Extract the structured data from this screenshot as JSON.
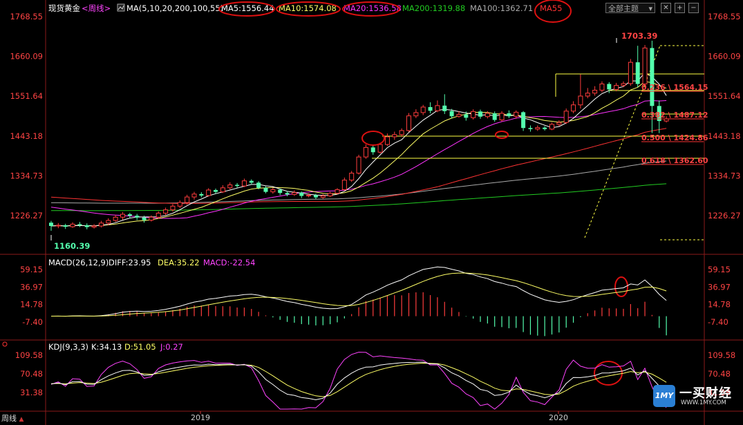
{
  "header": {
    "instrument": "现货黄金",
    "period_tag": "<周线>",
    "ma_params": "MA(5,10,20,200,100,55)",
    "ma5": "MA5:1556.44",
    "ma10": "MA10:1574.08",
    "ma20": "MA20:1536.58",
    "ma200": "MA200:1319.88",
    "ma100": "MA100:1362.71",
    "ma55": "MA55",
    "theme_button": "全部主题"
  },
  "macd_header": {
    "params": "MACD(26,12,9)",
    "diff": "DIFF:23.95",
    "dea": "DEA:35.22",
    "macd": "MACD:-22.54"
  },
  "kdj_header": {
    "params": "KDJ(9,3,3)",
    "k": "K:34.13",
    "d": "D:51.05",
    "j": "J:0.27"
  },
  "footer": {
    "period_button": "周线",
    "x_labels": [
      "2019",
      "2020"
    ]
  },
  "brand": {
    "logo_mark": "1MY",
    "name": "一买财经",
    "url": "WWW.1MY.COM"
  },
  "colors": {
    "up": "#ff3d3d",
    "down": "#54ffae",
    "ma5": "#ffffff",
    "ma10": "#ffff66",
    "ma20": "#ff33ff",
    "ma200": "#22cc22",
    "ma100": "#aaaaaa",
    "ma55": "#ff3333",
    "fib": "#ffff44",
    "annot": "#dd1111",
    "axis_text": "#ff4444"
  },
  "chart_data": [
    {
      "type": "candlestick",
      "title": "现货黄金<周线>",
      "y_ticks": [
        "1768.55",
        "1660.09",
        "1551.64",
        "1443.18",
        "1334.73",
        "1226.27"
      ],
      "ylim": [
        1150,
        1780
      ],
      "high_label": "1703.39",
      "low_label": "1160.39",
      "fibonacci": [
        {
          "ratio": "0.236",
          "price": "1564.15"
        },
        {
          "ratio": "0.382",
          "price": "1487.12"
        },
        {
          "ratio": "0.500",
          "price": "1424.86"
        },
        {
          "ratio": "0.618",
          "price": "1362.60"
        }
      ],
      "candles": [
        [
          1207,
          1198,
          1212,
          1185
        ],
        [
          1198,
          1200,
          1206,
          1192
        ],
        [
          1200,
          1196,
          1204,
          1190
        ],
        [
          1196,
          1203,
          1208,
          1193
        ],
        [
          1203,
          1200,
          1209,
          1195
        ],
        [
          1200,
          1195,
          1205,
          1189
        ],
        [
          1195,
          1198,
          1203,
          1191
        ],
        [
          1198,
          1206,
          1212,
          1194
        ],
        [
          1206,
          1213,
          1219,
          1200
        ],
        [
          1213,
          1222,
          1228,
          1209
        ],
        [
          1222,
          1230,
          1236,
          1215
        ],
        [
          1230,
          1226,
          1234,
          1219
        ],
        [
          1226,
          1221,
          1231,
          1214
        ],
        [
          1221,
          1214,
          1226,
          1207
        ],
        [
          1214,
          1222,
          1227,
          1210
        ],
        [
          1222,
          1233,
          1238,
          1218
        ],
        [
          1233,
          1242,
          1248,
          1228
        ],
        [
          1242,
          1252,
          1258,
          1237
        ],
        [
          1252,
          1262,
          1268,
          1247
        ],
        [
          1262,
          1277,
          1283,
          1256
        ],
        [
          1277,
          1285,
          1291,
          1270
        ],
        [
          1285,
          1281,
          1290,
          1276
        ],
        [
          1281,
          1296,
          1301,
          1278
        ],
        [
          1296,
          1291,
          1300,
          1286
        ],
        [
          1291,
          1302,
          1309,
          1288
        ],
        [
          1302,
          1310,
          1317,
          1298
        ],
        [
          1310,
          1307,
          1315,
          1302
        ],
        [
          1307,
          1321,
          1327,
          1304
        ],
        [
          1321,
          1316,
          1325,
          1311
        ],
        [
          1316,
          1302,
          1320,
          1298
        ],
        [
          1302,
          1291,
          1306,
          1287
        ],
        [
          1291,
          1297,
          1302,
          1286
        ],
        [
          1297,
          1288,
          1300,
          1282
        ],
        [
          1288,
          1284,
          1293,
          1279
        ],
        [
          1284,
          1289,
          1295,
          1280
        ],
        [
          1289,
          1280,
          1292,
          1274
        ],
        [
          1280,
          1282,
          1287,
          1276
        ],
        [
          1282,
          1276,
          1286,
          1271
        ],
        [
          1276,
          1280,
          1285,
          1272
        ],
        [
          1280,
          1287,
          1291,
          1277
        ],
        [
          1287,
          1297,
          1301,
          1284
        ],
        [
          1297,
          1323,
          1330,
          1294
        ],
        [
          1323,
          1342,
          1348,
          1318
        ],
        [
          1342,
          1386,
          1392,
          1338
        ],
        [
          1386,
          1412,
          1420,
          1381
        ],
        [
          1412,
          1399,
          1420,
          1392
        ],
        [
          1399,
          1420,
          1425,
          1395
        ],
        [
          1420,
          1441,
          1450,
          1416
        ],
        [
          1441,
          1447,
          1455,
          1433
        ],
        [
          1447,
          1458,
          1464,
          1441
        ],
        [
          1458,
          1498,
          1506,
          1454
        ],
        [
          1498,
          1507,
          1516,
          1492
        ],
        [
          1507,
          1522,
          1528,
          1500
        ],
        [
          1522,
          1512,
          1535,
          1505
        ],
        [
          1512,
          1526,
          1540,
          1508
        ],
        [
          1526,
          1511,
          1557,
          1503
        ],
        [
          1511,
          1497,
          1517,
          1491
        ],
        [
          1497,
          1502,
          1511,
          1493
        ],
        [
          1502,
          1493,
          1510,
          1485
        ],
        [
          1493,
          1510,
          1516,
          1488
        ],
        [
          1510,
          1496,
          1515,
          1490
        ],
        [
          1496,
          1505,
          1511,
          1491
        ],
        [
          1505,
          1487,
          1510,
          1482
        ],
        [
          1487,
          1505,
          1511,
          1483
        ],
        [
          1505,
          1497,
          1513,
          1492
        ],
        [
          1497,
          1508,
          1513,
          1490
        ],
        [
          1508,
          1465,
          1511,
          1457
        ],
        [
          1465,
          1462,
          1472,
          1455
        ],
        [
          1462,
          1466,
          1472,
          1457
        ],
        [
          1466,
          1462,
          1470,
          1458
        ],
        [
          1462,
          1475,
          1480,
          1459
        ],
        [
          1475,
          1480,
          1486,
          1470
        ],
        [
          1480,
          1511,
          1518,
          1476
        ],
        [
          1511,
          1528,
          1538,
          1505
        ],
        [
          1528,
          1552,
          1611,
          1518
        ],
        [
          1552,
          1560,
          1574,
          1546
        ],
        [
          1560,
          1568,
          1579,
          1553
        ],
        [
          1568,
          1585,
          1592,
          1562
        ],
        [
          1585,
          1570,
          1590,
          1560
        ],
        [
          1570,
          1581,
          1588,
          1565
        ],
        [
          1581,
          1586,
          1592,
          1576
        ],
        [
          1586,
          1644,
          1653,
          1580
        ],
        [
          1644,
          1585,
          1689,
          1576
        ],
        [
          1585,
          1683,
          1691,
          1575
        ],
        [
          1683,
          1525,
          1703,
          1451
        ],
        [
          1525,
          1484,
          1540,
          1451
        ],
        [
          1484,
          1490,
          1497,
          1480
        ]
      ],
      "moving_averages": [
        {
          "name": "MA5",
          "value": 1556.44
        },
        {
          "name": "MA10",
          "value": 1574.08
        },
        {
          "name": "MA20",
          "value": 1536.58
        },
        {
          "name": "MA200",
          "value": 1319.88
        },
        {
          "name": "MA100",
          "value": 1362.71
        },
        {
          "name": "MA55"
        }
      ]
    },
    {
      "type": "bar",
      "title": "MACD(26,12,9)",
      "y_ticks": [
        "59.15",
        "36.97",
        "14.78",
        "-7.40"
      ],
      "ylim": [
        -25,
        65
      ],
      "series": [
        {
          "name": "DIFF",
          "value": 23.95
        },
        {
          "name": "DEA",
          "value": 35.22
        },
        {
          "name": "MACD",
          "value": -22.54
        }
      ]
    },
    {
      "type": "line",
      "title": "KDJ(9,3,3)",
      "y_ticks": [
        "109.58",
        "70.48",
        "31.38"
      ],
      "ylim": [
        0,
        120
      ],
      "series": [
        {
          "name": "K",
          "value": 34.13
        },
        {
          "name": "D",
          "value": 51.05
        },
        {
          "name": "J",
          "value": 0.27
        }
      ]
    }
  ]
}
